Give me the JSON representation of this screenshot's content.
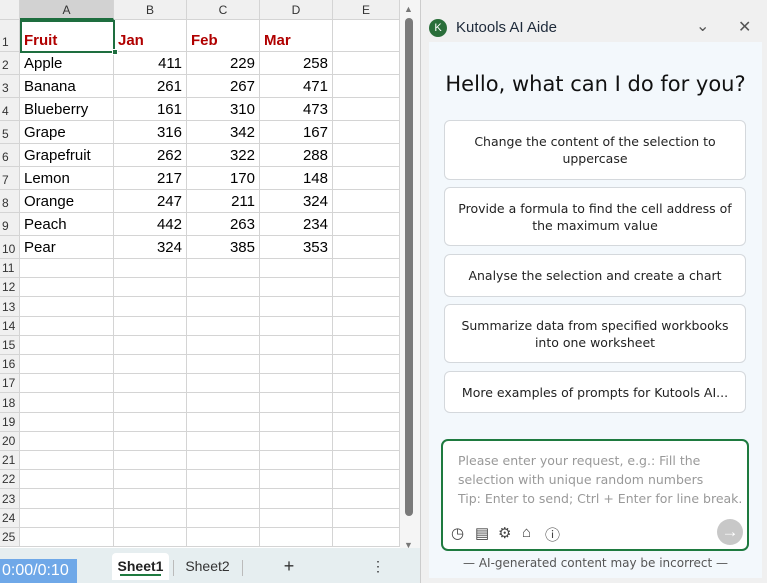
{
  "sheet": {
    "columns": [
      "A",
      "B",
      "C",
      "D",
      "E"
    ],
    "headers": [
      "Fruit",
      "Jan",
      "Feb",
      "Mar"
    ],
    "rows": [
      [
        "Apple",
        "411",
        "229",
        "258"
      ],
      [
        "Banana",
        "261",
        "267",
        "471"
      ],
      [
        "Blueberry",
        "161",
        "310",
        "473"
      ],
      [
        "Grape",
        "316",
        "342",
        "167"
      ],
      [
        "Grapefruit",
        "262",
        "322",
        "288"
      ],
      [
        "Lemon",
        "217",
        "170",
        "148"
      ],
      [
        "Orange",
        "247",
        "211",
        "324"
      ],
      [
        "Peach",
        "442",
        "263",
        "234"
      ],
      [
        "Pear",
        "324",
        "385",
        "353"
      ]
    ],
    "row_numbers": [
      "1",
      "2",
      "3",
      "4",
      "5",
      "6",
      "7",
      "8",
      "9",
      "10",
      "11",
      "12",
      "13",
      "14",
      "15",
      "16",
      "17",
      "18",
      "19",
      "20",
      "21",
      "22",
      "23",
      "24",
      "25"
    ]
  },
  "bottom": {
    "timer": "0:00/0:10",
    "tabs": [
      "Sheet1",
      "Sheet2"
    ],
    "add": "+",
    "more": "⋮"
  },
  "panel": {
    "title": "Kutools AI Aide",
    "greeting": "Hello, what can I do for you?",
    "suggestions": [
      "Change the content of the selection to uppercase",
      "Provide a formula to find the cell address of the maximum value",
      "Analyse the selection and create a chart",
      "Summarize data from specified workbooks into one worksheet",
      "More examples of prompts for Kutools AI..."
    ],
    "placeholder_lines": [
      "Please enter your request, e.g.: Fill the",
      "selection with unique random numbers",
      "Tip: Enter to send; Ctrl + Enter for line break."
    ],
    "disclaimer": "— AI-generated content may be incorrect —"
  },
  "colors": {
    "accent": "#1e7a3f",
    "header_text": "#b00000"
  }
}
